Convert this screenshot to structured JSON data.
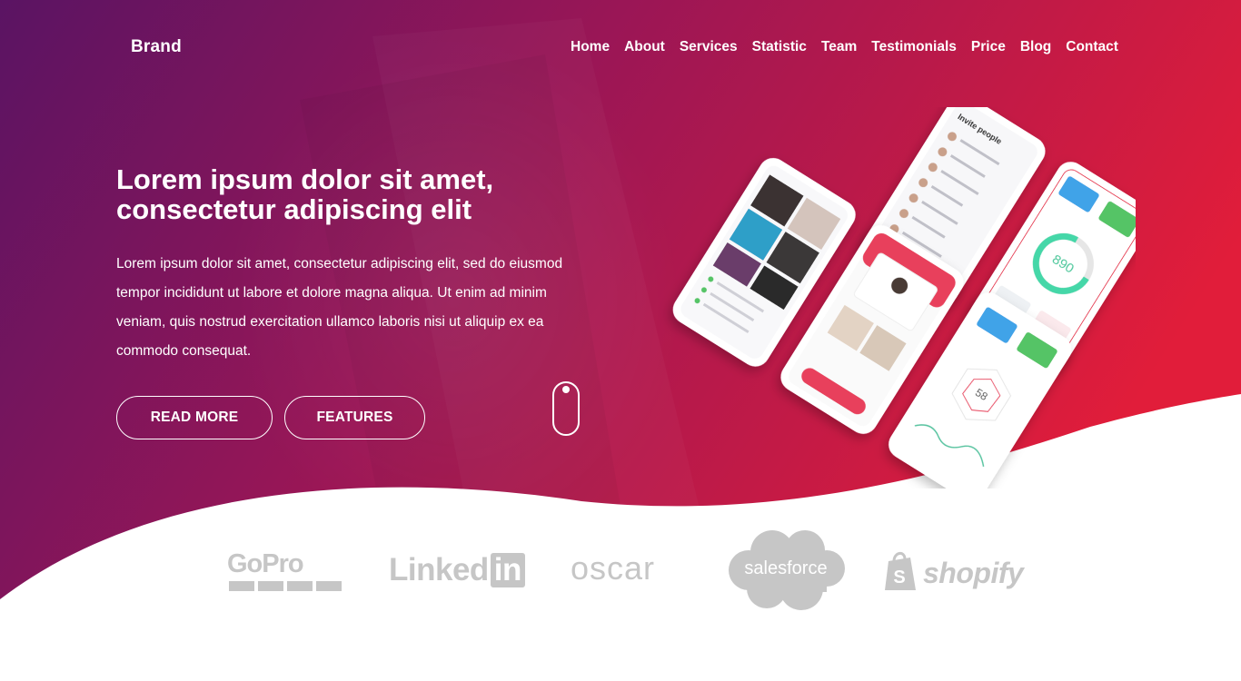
{
  "brand": "Brand",
  "nav": {
    "links": [
      "Home",
      "About",
      "Services",
      "Statistic",
      "Team",
      "Testimonials",
      "Price",
      "Blog",
      "Contact"
    ]
  },
  "hero": {
    "title_line1": "Lorem ipsum dolor sit amet,",
    "title_line2": "consectetur adipiscing elit",
    "text": "Lorem ipsum dolor sit amet, consectetur adipiscing elit, sed do eiusmod tempor incididunt ut labore et dolore magna aliqua. Ut enim ad minim veniam, quis nostrud exercitation ullamco laboris nisi ut aliquip ex ea commodo consequat.",
    "read_more_label": "READ MORE",
    "features_label": "FEATURES"
  },
  "mockups": {
    "invite_title": "Invite people",
    "gauge_value": "890",
    "radar_value": "58"
  },
  "partners": {
    "gopro": "GoPro",
    "linkedin_text": "Linked",
    "linkedin_box": "in",
    "oscar": "oscar",
    "salesforce": "salesforce",
    "shopify": "shopify"
  },
  "colors": {
    "gradient_start": "#5a1463",
    "gradient_mid": "#9a1656",
    "gradient_end": "#e11d3a",
    "logo_gray": "#c6c6c6"
  }
}
